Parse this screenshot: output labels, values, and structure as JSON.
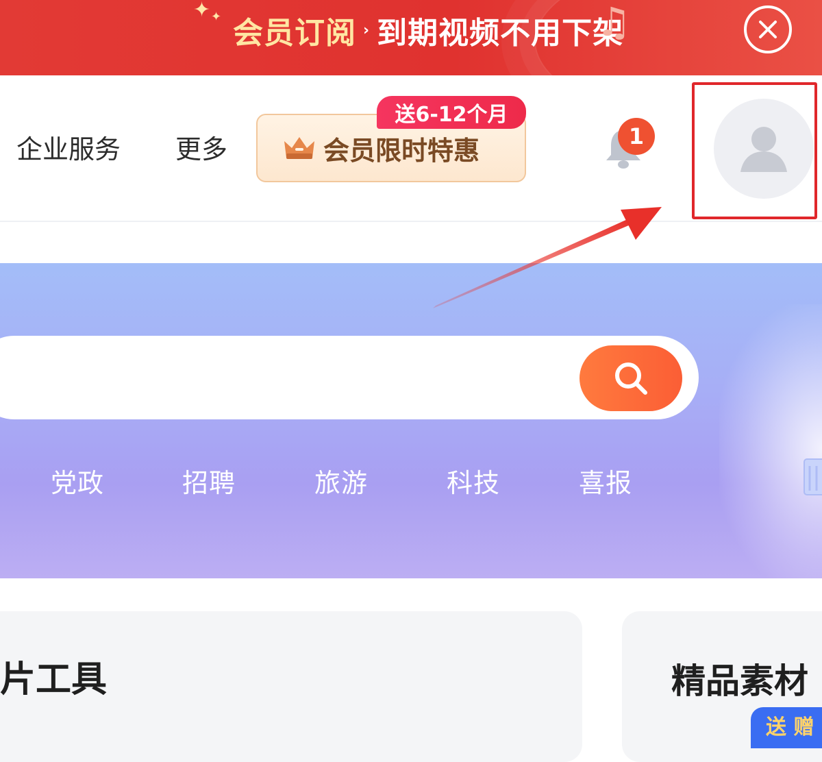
{
  "promo_banner": {
    "highlight_text": "会员订阅",
    "separator": "›",
    "rest_text": "到期视频不用下架",
    "icons": {
      "sparkle": "sparkle-icon",
      "music": "music-note-icon",
      "close": "close-circle-icon"
    },
    "colors": {
      "background": "#e23a35",
      "highlight": "#ffe6a3"
    }
  },
  "header": {
    "nav": [
      {
        "label": "企业服务"
      },
      {
        "label": "更多"
      }
    ],
    "vip_button": {
      "label": "会员限时特惠",
      "badge": "送6-12个月",
      "icon": "crown-icon"
    },
    "notifications": {
      "icon": "bell-icon",
      "count": "1"
    },
    "avatar": {
      "icon": "user-avatar-icon"
    }
  },
  "hero": {
    "search": {
      "placeholder": "",
      "button_icon": "search-icon"
    },
    "tags": [
      {
        "label": "党政"
      },
      {
        "label": "招聘"
      },
      {
        "label": "旅游"
      },
      {
        "label": "科技"
      },
      {
        "label": "喜报"
      }
    ]
  },
  "sections": {
    "left_title": "片工具",
    "right_title": "精品素材",
    "right_badge": "送 赠"
  },
  "colors": {
    "accent_orange": "#fb5e35",
    "highlight_box": "#e0272b",
    "vip_badge": "#f5355f"
  }
}
